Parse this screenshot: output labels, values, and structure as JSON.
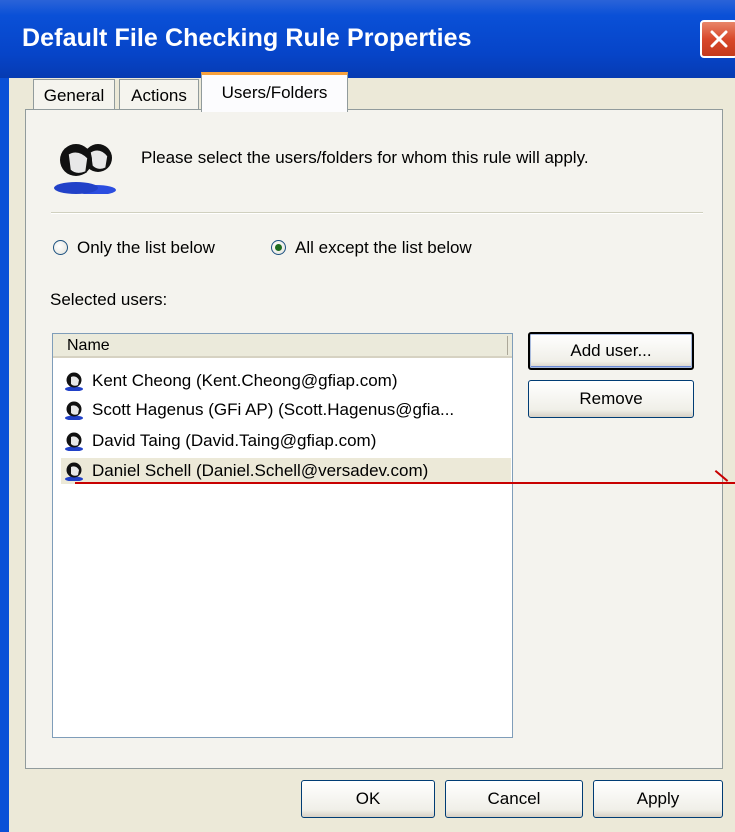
{
  "window": {
    "title": "Default File Checking Rule Properties"
  },
  "tabs": [
    {
      "label": "General",
      "active": false
    },
    {
      "label": "Actions",
      "active": false
    },
    {
      "label": "Users/Folders",
      "active": true
    }
  ],
  "panel": {
    "intro_text": "Please select the users/folders for whom this rule will apply.",
    "radio_only": "Only the list below",
    "radio_except": "All except the list below",
    "selected_option": "All except the list below",
    "selected_users_label": "Selected users:"
  },
  "list": {
    "column_header": "Name",
    "users": [
      "Kent Cheong (Kent.Cheong@gfiap.com)",
      "Scott Hagenus (GFi AP) (Scott.Hagenus@gfia...",
      "David Taing (David.Taing@gfiap.com)",
      "Daniel Schell (Daniel.Schell@versadev.com)"
    ]
  },
  "buttons": {
    "add_user": "Add user...",
    "remove": "Remove",
    "ok": "OK",
    "cancel": "Cancel",
    "apply": "Apply"
  },
  "colors": {
    "titlebar": "#0a50d7",
    "tab_active_accent": "#f7a13d",
    "annotation_line": "#c80000"
  }
}
